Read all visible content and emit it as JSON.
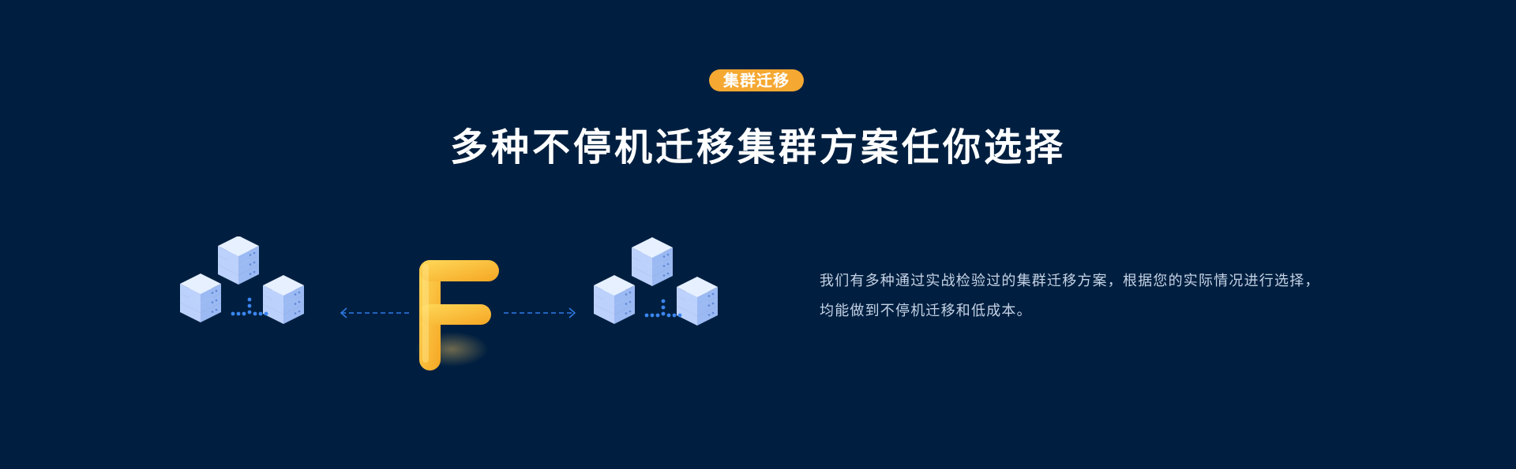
{
  "section": {
    "badge_label": "集群迁移",
    "headline": "多种不停机迁移集群方案任你选择",
    "description_line1": "我们有多种通过实战检验过的集群迁移方案，根据您的实际情况进行选择，",
    "description_line2": "均能做到不停机迁移和低成本。"
  },
  "illustration": {
    "left_icon": "server-cluster-icon",
    "center_icon": "letter-f-logo-icon",
    "right_icon": "server-cluster-icon",
    "connector_left_icon": "arrow-left-icon",
    "connector_right_icon": "arrow-right-icon"
  },
  "colors": {
    "background": "#001f40",
    "badge": "#f5a832",
    "headline": "#ffffff",
    "description": "#c6d3e6",
    "server_light": "#d9e7ff",
    "server_mid": "#b7cdfa",
    "server_dark": "#8eadf0",
    "accent_blue": "#2f7be8",
    "logo_yellow": "#fdd44a"
  }
}
